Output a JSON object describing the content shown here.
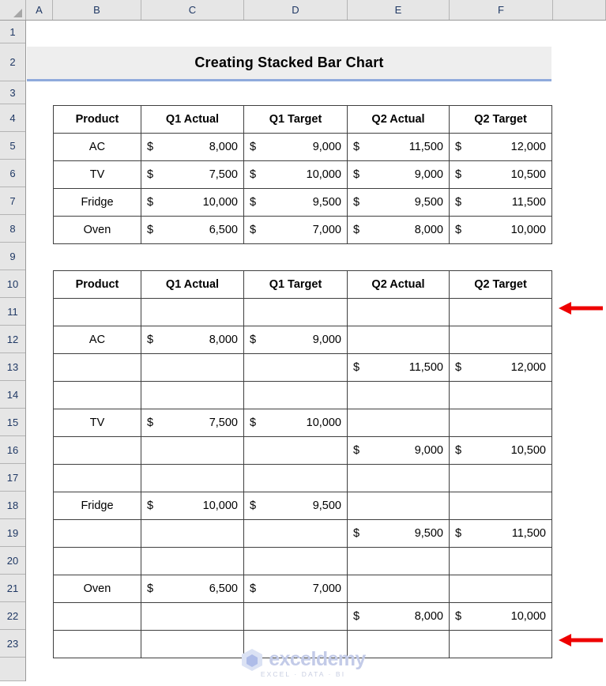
{
  "app": {
    "type": "spreadsheet",
    "title": "Creating Stacked Bar Chart"
  },
  "grid": {
    "column_headers": [
      "A",
      "B",
      "C",
      "D",
      "E",
      "F"
    ],
    "row_numbers": [
      "1",
      "2",
      "3",
      "4",
      "5",
      "6",
      "7",
      "8",
      "9",
      "10",
      "11",
      "12",
      "13",
      "14",
      "15",
      "16",
      "17",
      "18",
      "19",
      "20",
      "21",
      "22",
      "23"
    ]
  },
  "colors": {
    "header_green": "#c6e0b4",
    "header_yellow": "#ffe699",
    "header_pink": "#fce4d6",
    "title_background": "#eeeeee",
    "title_underline": "#8faadc",
    "arrow_red": "#ee0000",
    "grid_header_bg": "#e6e6e6",
    "cell_border": "#3f3f3f"
  },
  "table1": {
    "headers": [
      "Product",
      "Q1 Actual",
      "Q1 Target",
      "Q2 Actual",
      "Q2 Target"
    ],
    "rows": [
      {
        "product": "AC",
        "q1_actual": "8,000",
        "q1_target": "9,000",
        "q2_actual": "11,500",
        "q2_target": "12,000"
      },
      {
        "product": "TV",
        "q1_actual": "7,500",
        "q1_target": "10,000",
        "q2_actual": "9,000",
        "q2_target": "10,500"
      },
      {
        "product": "Fridge",
        "q1_actual": "10,000",
        "q1_target": "9,500",
        "q2_actual": "9,500",
        "q2_target": "11,500"
      },
      {
        "product": "Oven",
        "q1_actual": "6,500",
        "q1_target": "7,000",
        "q2_actual": "8,000",
        "q2_target": "10,000"
      }
    ]
  },
  "table2": {
    "headers": [
      "Product",
      "Q1 Actual",
      "Q1 Target",
      "Q2 Actual",
      "Q2 Target"
    ],
    "currency_symbol": "$",
    "rows": [
      {
        "product": "",
        "q1_actual": "",
        "q1_target": "",
        "q2_actual": "",
        "q2_target": ""
      },
      {
        "product": "AC",
        "q1_actual": "8,000",
        "q1_target": "9,000",
        "q2_actual": "",
        "q2_target": ""
      },
      {
        "product": "",
        "q1_actual": "",
        "q1_target": "",
        "q2_actual": "11,500",
        "q2_target": "12,000"
      },
      {
        "product": "",
        "q1_actual": "",
        "q1_target": "",
        "q2_actual": "",
        "q2_target": ""
      },
      {
        "product": "TV",
        "q1_actual": "7,500",
        "q1_target": "10,000",
        "q2_actual": "",
        "q2_target": ""
      },
      {
        "product": "",
        "q1_actual": "",
        "q1_target": "",
        "q2_actual": "9,000",
        "q2_target": "10,500"
      },
      {
        "product": "",
        "q1_actual": "",
        "q1_target": "",
        "q2_actual": "",
        "q2_target": ""
      },
      {
        "product": "Fridge",
        "q1_actual": "10,000",
        "q1_target": "9,500",
        "q2_actual": "",
        "q2_target": ""
      },
      {
        "product": "",
        "q1_actual": "",
        "q1_target": "",
        "q2_actual": "9,500",
        "q2_target": "11,500"
      },
      {
        "product": "",
        "q1_actual": "",
        "q1_target": "",
        "q2_actual": "",
        "q2_target": ""
      },
      {
        "product": "Oven",
        "q1_actual": "6,500",
        "q1_target": "7,000",
        "q2_actual": "",
        "q2_target": ""
      },
      {
        "product": "",
        "q1_actual": "",
        "q1_target": "",
        "q2_actual": "8,000",
        "q2_target": "10,000"
      },
      {
        "product": "",
        "q1_actual": "",
        "q1_target": "",
        "q2_actual": "",
        "q2_target": ""
      }
    ]
  },
  "annotations": [
    {
      "name": "arrow-top",
      "icon": "arrow-left-icon",
      "points_to_row": "11"
    },
    {
      "name": "arrow-bottom",
      "icon": "arrow-left-icon",
      "points_to_row": "23"
    }
  ],
  "watermark": {
    "brand": "exceldemy",
    "tagline": "EXCEL · DATA · BI"
  }
}
